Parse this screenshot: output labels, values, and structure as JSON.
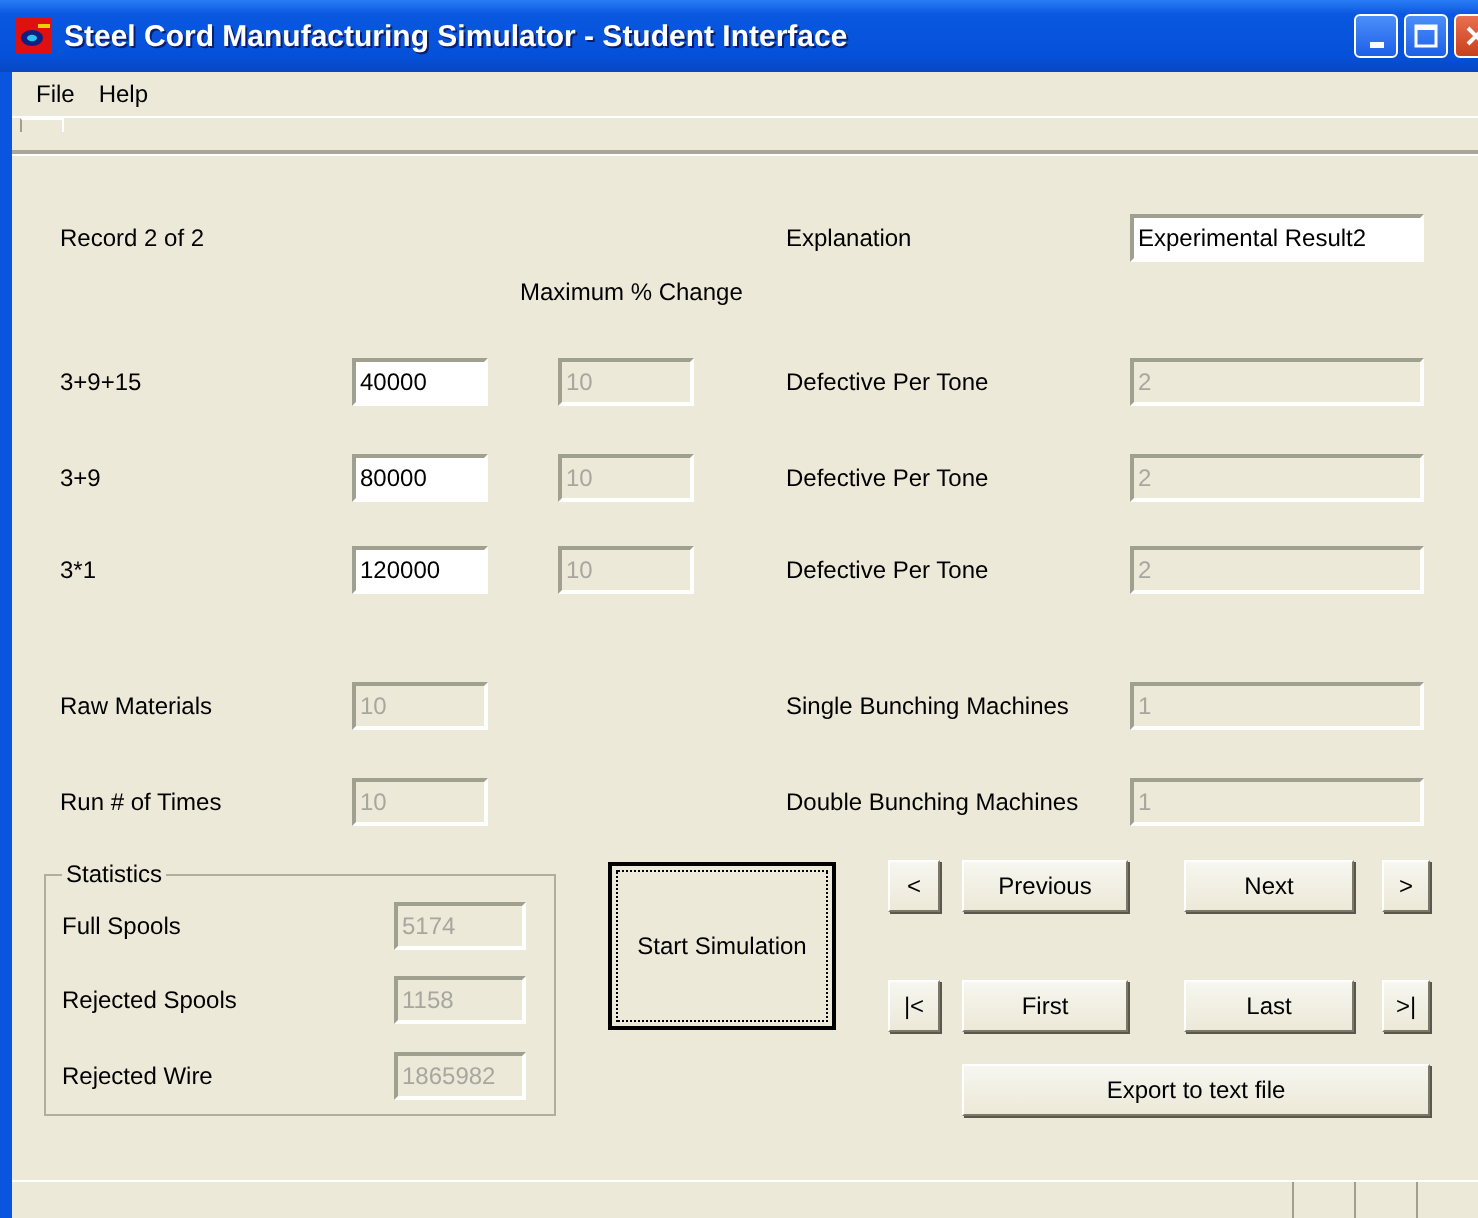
{
  "window": {
    "title": "Steel Cord Manufacturing Simulator - Student Interface"
  },
  "menu": [
    {
      "label": "File"
    },
    {
      "label": "Help"
    }
  ],
  "record_label": "Record 2 of 2",
  "explanation": {
    "label": "Explanation",
    "value": "Experimental Result2",
    "disabled": false
  },
  "max_change_label": "Maximum % Change",
  "products": [
    {
      "label": "3+9+15",
      "quantity": {
        "value": "40000",
        "disabled": false
      },
      "max_change": {
        "value": "10",
        "disabled": true
      },
      "defective_label": "Defective Per Tone",
      "defective": {
        "value": "2",
        "disabled": true
      }
    },
    {
      "label": "3+9",
      "quantity": {
        "value": "80000",
        "disabled": false
      },
      "max_change": {
        "value": "10",
        "disabled": true
      },
      "defective_label": "Defective Per Tone",
      "defective": {
        "value": "2",
        "disabled": true
      }
    },
    {
      "label": "3*1",
      "quantity": {
        "value": "120000",
        "disabled": false
      },
      "max_change": {
        "value": "10",
        "disabled": true
      },
      "defective_label": "Defective Per Tone",
      "defective": {
        "value": "2",
        "disabled": true
      }
    }
  ],
  "raw_materials": {
    "label": "Raw Materials",
    "value": "10",
    "disabled": true
  },
  "single_bunching": {
    "label": "Single Bunching Machines",
    "value": "1",
    "disabled": true
  },
  "runs": {
    "label": "Run # of Times",
    "value": "10",
    "disabled": true
  },
  "double_bunching": {
    "label": "Double Bunching Machines",
    "value": "1",
    "disabled": true
  },
  "statistics": {
    "title": "Statistics",
    "rows": [
      {
        "label": "Full Spools",
        "value": "5174",
        "disabled": true
      },
      {
        "label": "Rejected Spools",
        "value": "1158",
        "disabled": true
      },
      {
        "label": "Rejected Wire",
        "value": "1865982",
        "disabled": true
      }
    ]
  },
  "start_button": "Start Simulation",
  "nav_buttons": [
    {
      "label": "<"
    },
    {
      "label": "Previous"
    },
    {
      "label": "Next"
    },
    {
      "label": ">"
    },
    {
      "label": "|<"
    },
    {
      "label": "First"
    },
    {
      "label": "Last"
    },
    {
      "label": ">|"
    }
  ],
  "export_button": "Export to text file"
}
